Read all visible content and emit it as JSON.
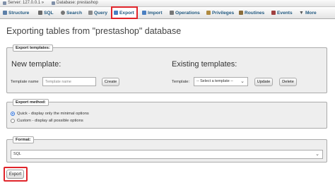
{
  "breadcrumb": {
    "server": "Server: 127.0.0.1 »",
    "database": "Database: prestashop"
  },
  "tabs": [
    {
      "label": "Structure",
      "icon": "structure-icon",
      "color": "#5b7fa8"
    },
    {
      "label": "SQL",
      "icon": "sql-icon",
      "color": "#6a6a6a"
    },
    {
      "label": "Search",
      "icon": "search-icon",
      "color": "#777"
    },
    {
      "label": "Query",
      "icon": "query-icon",
      "color": "#8a8a8a"
    },
    {
      "label": "Export",
      "icon": "export-icon",
      "color": "#4a7fc1",
      "active": true
    },
    {
      "label": "Import",
      "icon": "import-icon",
      "color": "#4a7fc1"
    },
    {
      "label": "Operations",
      "icon": "operations-icon",
      "color": "#777"
    },
    {
      "label": "Privileges",
      "icon": "privileges-icon",
      "color": "#b08a40"
    },
    {
      "label": "Routines",
      "icon": "routines-icon",
      "color": "#8a6c3a"
    },
    {
      "label": "Events",
      "icon": "events-icon",
      "color": "#a04040"
    },
    {
      "label": "More",
      "icon": "more-chevron-icon",
      "color": "#555"
    }
  ],
  "page_title": "Exporting tables from \"prestashop\" database",
  "templates": {
    "legend": "Export templates:",
    "new_heading": "New template:",
    "existing_heading": "Existing templates:",
    "name_label": "Template name",
    "name_placeholder": "Template name",
    "create_label": "Create",
    "template_label": "Template:",
    "select_value": "-- Select a template --",
    "update_label": "Update",
    "delete_label": "Delete"
  },
  "method": {
    "legend": "Export method:",
    "options": [
      {
        "label": "Quick - display only the minimal options",
        "selected": true
      },
      {
        "label": "Custom - display all possible options",
        "selected": false
      }
    ]
  },
  "format": {
    "legend": "Format:",
    "value": "SQL"
  },
  "export_label": "Export",
  "accent": "#e0252b"
}
